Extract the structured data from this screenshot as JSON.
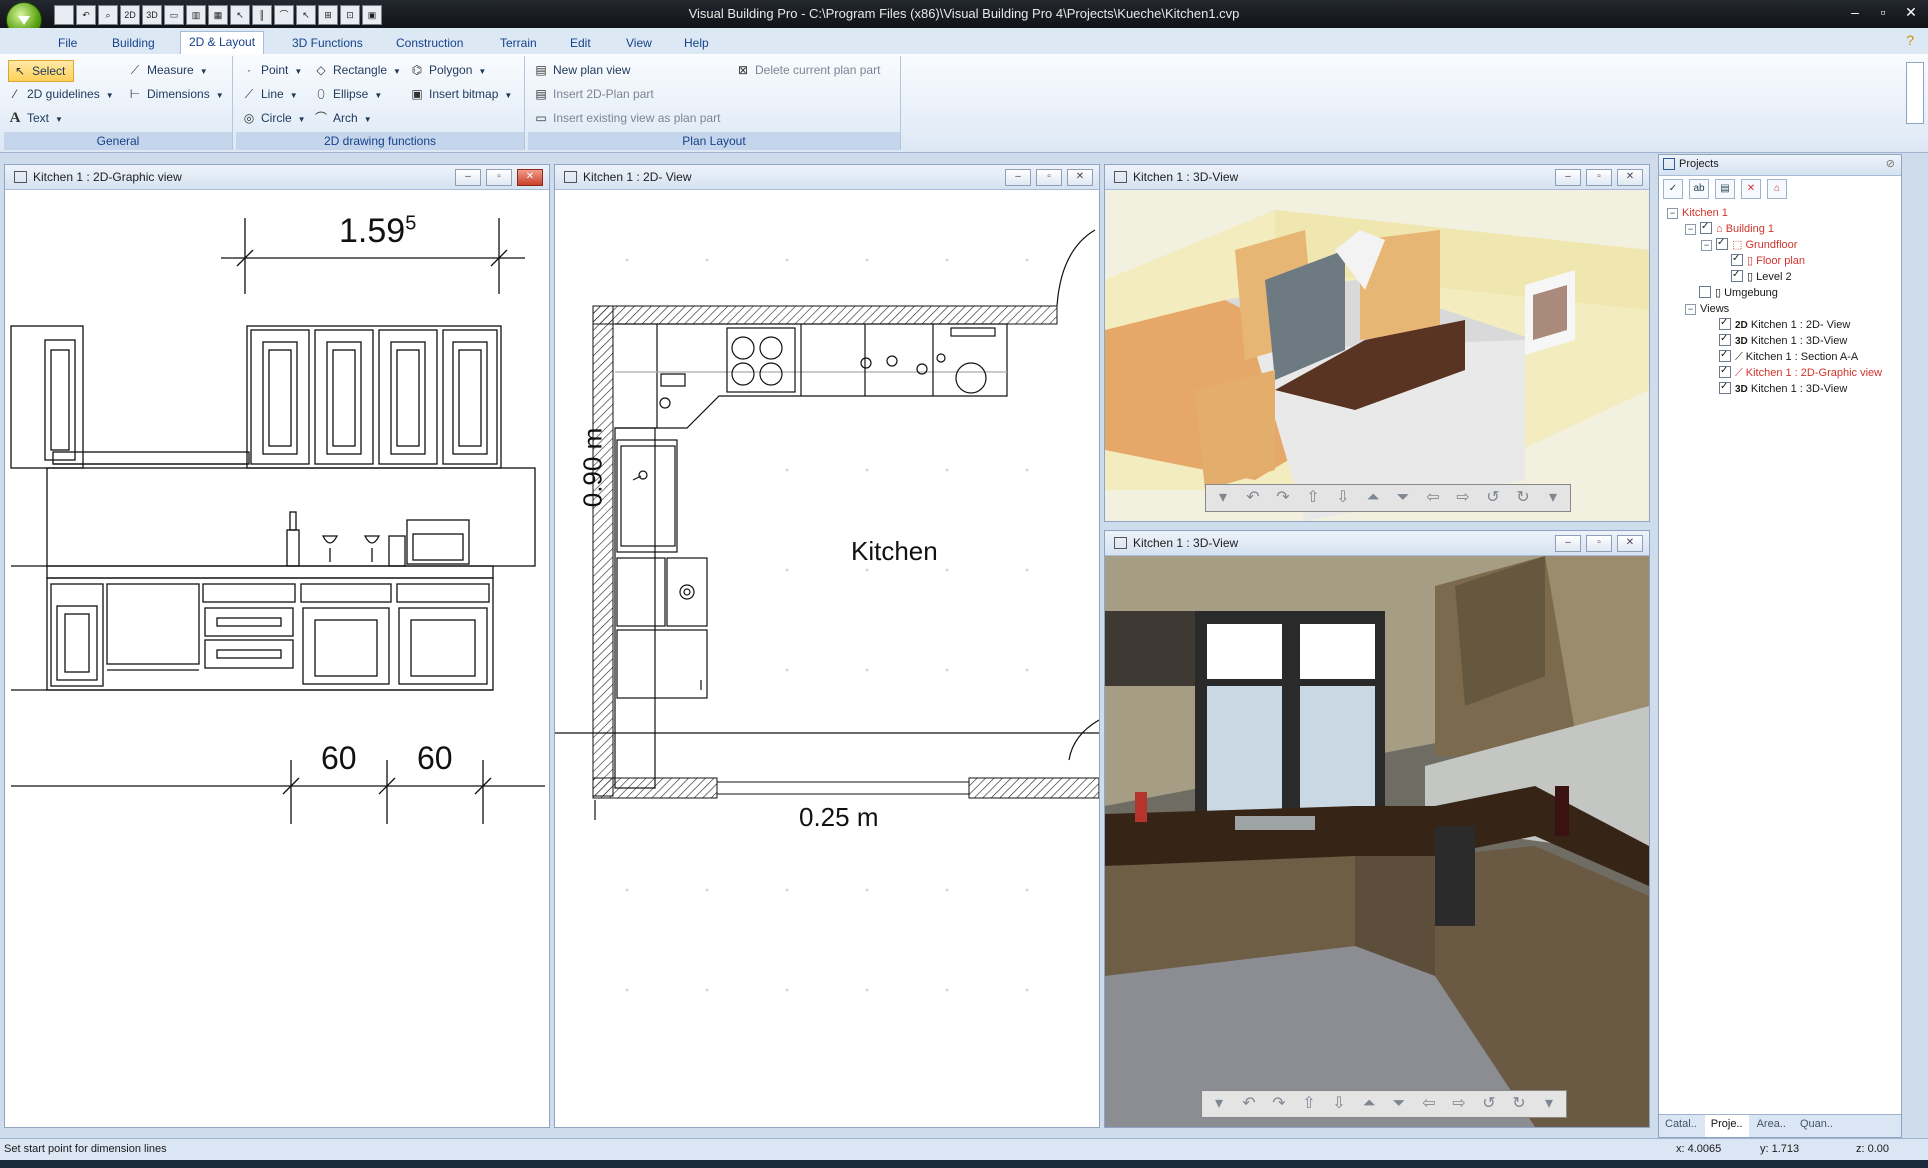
{
  "window": {
    "title": "Visual Building Pro - C:\\Program Files (x86)\\Visual Building Pro 4\\Projects\\Kueche\\Kitchen1.cvp",
    "qat_icons": [
      "new-icon",
      "undo-icon",
      "redo-icon",
      "2d-icon",
      "3d-icon",
      "view-icon",
      "layout-icon",
      "grid-icon",
      "select-icon",
      "guides-icon",
      "measure-icon",
      "pointer-icon",
      "snap-icon",
      "snap2-icon",
      "window-icon"
    ],
    "qat_labels": [
      "",
      "",
      "",
      "2D",
      "3D",
      "",
      "",
      "",
      "",
      "",
      "",
      "",
      "",
      "",
      ""
    ]
  },
  "ribbon": {
    "tabs": [
      "File",
      "Building",
      "2D & Layout",
      "3D Functions",
      "Construction",
      "Terrain",
      "Edit",
      "View",
      "Help"
    ],
    "active_tab": "2D & Layout",
    "general": {
      "label": "General",
      "select": "Select",
      "measure": "Measure",
      "guidelines": "2D guidelines",
      "dimensions": "Dimensions",
      "text": "Text"
    },
    "drawing": {
      "label": "2D drawing functions",
      "point": "Point",
      "rectangle": "Rectangle",
      "polygon": "Polygon",
      "line": "Line",
      "ellipse": "Ellipse",
      "insert_bitmap": "Insert bitmap",
      "circle": "Circle",
      "arch": "Arch"
    },
    "plan_layout": {
      "label": "Plan Layout",
      "new_plan_view": "New plan view",
      "delete_plan_part": "Delete current plan part",
      "insert_2d_plan_part": "Insert 2D-Plan part",
      "insert_existing_view": "Insert existing view as plan part"
    }
  },
  "panels": {
    "graphic_view": {
      "title": "Kitchen 1 : 2D-Graphic view",
      "dim_top": "1.59",
      "dim_top_sup": "5",
      "dim_bottom_1": "60",
      "dim_bottom_2": "60"
    },
    "plan_view": {
      "title": "Kitchen 1 : 2D- View",
      "room_label": "Kitchen",
      "dim_vertical": "0.90 m",
      "dim_horizontal": "0.25 m"
    },
    "view3d_top": {
      "title": "Kitchen 1 : 3D-View"
    },
    "view3d_bottom": {
      "title": "Kitchen 1 : 3D-View"
    }
  },
  "projects": {
    "title": "Projects",
    "tree": [
      {
        "label": "Kitchen 1",
        "level": 0,
        "red": true
      },
      {
        "label": "Building 1",
        "level": 1,
        "red": true
      },
      {
        "label": "Grundfloor",
        "level": 2,
        "red": true
      },
      {
        "label": "Floor plan",
        "level": 3,
        "red": true
      },
      {
        "label": "Level 2",
        "level": 3,
        "red": false
      },
      {
        "label": "Umgebung",
        "level": 1,
        "red": false
      },
      {
        "label": "Views",
        "level": 0,
        "red": false
      },
      {
        "label": "Kitchen 1 : 2D- View",
        "prefix": "2D",
        "red": false
      },
      {
        "label": "Kitchen 1 : 3D-View",
        "prefix": "3D",
        "red": false
      },
      {
        "label": "Kitchen 1 : Section A-A",
        "prefix": "",
        "red": false
      },
      {
        "label": "Kitchen 1 : 2D-Graphic view",
        "prefix": "",
        "red": true
      },
      {
        "label": "Kitchen 1 : 3D-View",
        "prefix": "3D",
        "red": false
      }
    ],
    "bottom_tabs": [
      "Catal..",
      "Proje..",
      "Area..",
      "Quan.."
    ],
    "active_bottom_tab": "Proje.."
  },
  "status": {
    "message": "Set start point for dimension lines",
    "x": "x: 4.0065",
    "y": "y: 1.713",
    "z": "z: 0.00"
  }
}
